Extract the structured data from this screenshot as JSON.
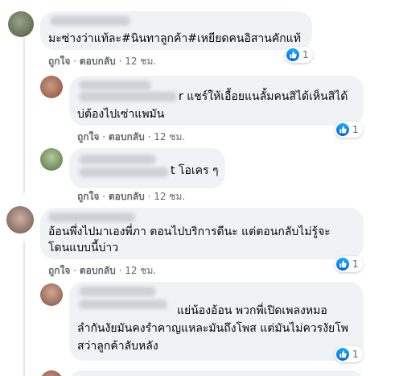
{
  "comments": [
    {
      "text_lines": [
        "มะซ่างว่าแท้ละ#นินทาลูกค้า#เหยียดคนอิสานคักแท้"
      ],
      "actions": {
        "like": "ถูกใจ",
        "reply": "ตอบกลับ",
        "time": "12 ชม."
      },
      "reactions": "1"
    },
    {
      "text_lines": [
        "r แชร์ให้เอื้อยแนลั้มคนสิได้เห็นสิได้",
        "บ่ต้องไปเซ่าแพมัน"
      ],
      "actions": {
        "like": "ถูกใจ",
        "reply": "ตอบกลับ",
        "time": "12 ชม."
      },
      "reactions": "1"
    },
    {
      "text_lines": [
        "t โอเคร ๆ"
      ],
      "actions": {
        "like": "ถูกใจ",
        "reply": "ตอบกลับ",
        "time": "12 ชม."
      }
    },
    {
      "text_lines": [
        "อ้อนพึ่งไปมาเองพี่ภา ตอนไปบริการดีนะ แต่ตอนกลับไม่รู้จะ",
        "โดนแบบนี้บ่าว"
      ],
      "actions": {
        "like": "ถูกใจ",
        "reply": "ตอบกลับ",
        "time": "12 ชม."
      },
      "reactions": "1"
    },
    {
      "text_lines": [
        "แย่น้องอ้อน พวกพี่เปิดเพลงหมอ",
        "ลำกันงัยมันคงรำคาญแหละมันถึงโพส แต่มันไม่ควรงัยโพ",
        "สว่าลูกค้าลับหลัง"
      ],
      "reactions": "1"
    }
  ]
}
